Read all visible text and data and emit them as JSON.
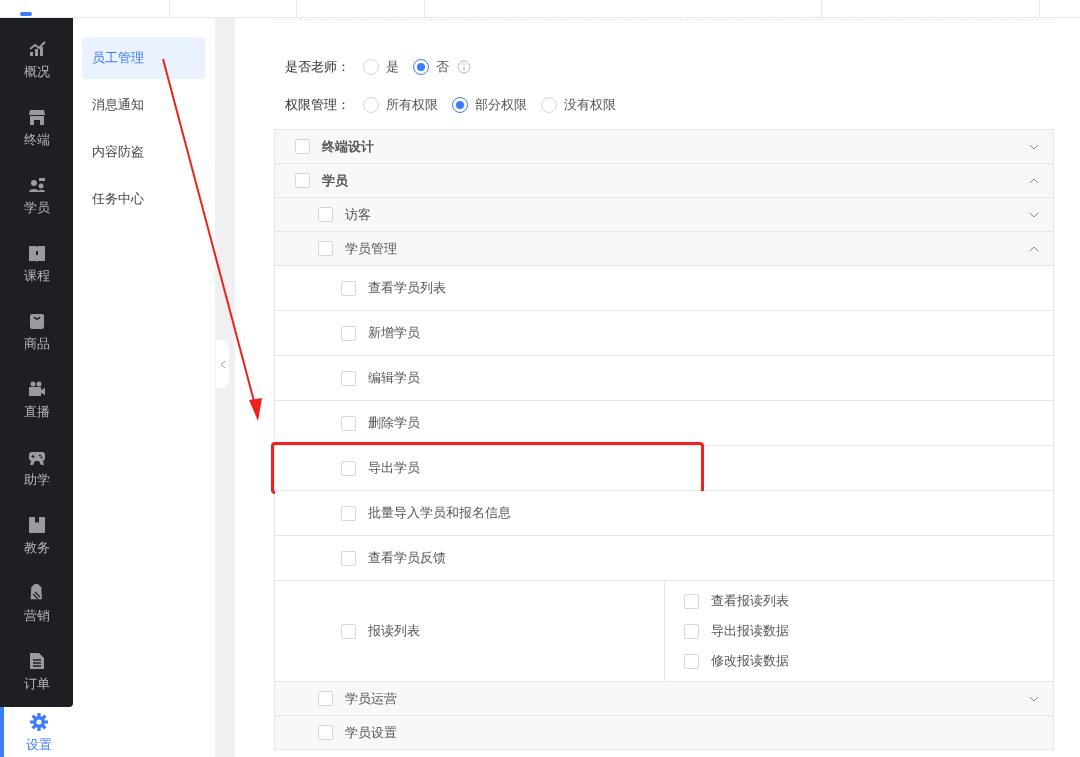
{
  "main_nav": [
    {
      "label": "概况",
      "selected": false
    },
    {
      "label": "终端",
      "selected": false
    },
    {
      "label": "学员",
      "selected": false
    },
    {
      "label": "课程",
      "selected": false
    },
    {
      "label": "商品",
      "selected": false
    },
    {
      "label": "直播",
      "selected": false
    },
    {
      "label": "助学",
      "selected": false
    },
    {
      "label": "教务",
      "selected": false
    },
    {
      "label": "营销",
      "selected": false
    },
    {
      "label": "订单",
      "selected": false
    },
    {
      "label": "设置",
      "selected": true
    }
  ],
  "sub_nav": [
    {
      "label": "员工管理",
      "selected": true
    },
    {
      "label": "消息通知",
      "selected": false
    },
    {
      "label": "内容防盗",
      "selected": false
    },
    {
      "label": "任务中心",
      "selected": false
    }
  ],
  "form": [
    {
      "label": "是否老师：",
      "info": true,
      "options": [
        {
          "label": "是",
          "selected": false
        },
        {
          "label": "否",
          "selected": true
        }
      ]
    },
    {
      "label": "权限管理：",
      "info": false,
      "options": [
        {
          "label": "所有权限",
          "selected": false
        },
        {
          "label": "部分权限",
          "selected": true
        },
        {
          "label": "没有权限",
          "selected": false
        }
      ]
    }
  ],
  "permissions": [
    {
      "label": "终端设计",
      "checked": false,
      "expanded": false
    },
    {
      "label": "学员",
      "checked": false,
      "expanded": true,
      "children": [
        {
          "label": "访客",
          "checked": false,
          "expanded": false
        },
        {
          "label": "学员管理",
          "checked": false,
          "expanded": true,
          "items": [
            {
              "label": "查看学员列表",
              "checked": false,
              "highlighted": false
            },
            {
              "label": "新增学员",
              "checked": false,
              "highlighted": false
            },
            {
              "label": "编辑学员",
              "checked": false,
              "highlighted": false
            },
            {
              "label": "删除学员",
              "checked": false,
              "highlighted": false
            },
            {
              "label": "导出学员",
              "checked": false,
              "highlighted": true
            },
            {
              "label": "批量导入学员和报名信息",
              "checked": false,
              "highlighted": false
            },
            {
              "label": "查看学员反馈",
              "checked": false,
              "highlighted": false
            },
            {
              "label": "报读列表",
              "checked": false,
              "highlighted": false,
              "items": [
                {
                  "label": "查看报读列表",
                  "checked": false
                },
                {
                  "label": "导出报读数据",
                  "checked": false
                },
                {
                  "label": "修改报读数据",
                  "checked": false
                }
              ]
            }
          ]
        },
        {
          "label": "学员运营",
          "checked": false,
          "expanded": false
        },
        {
          "label": "学员设置",
          "checked": false
        }
      ]
    }
  ]
}
